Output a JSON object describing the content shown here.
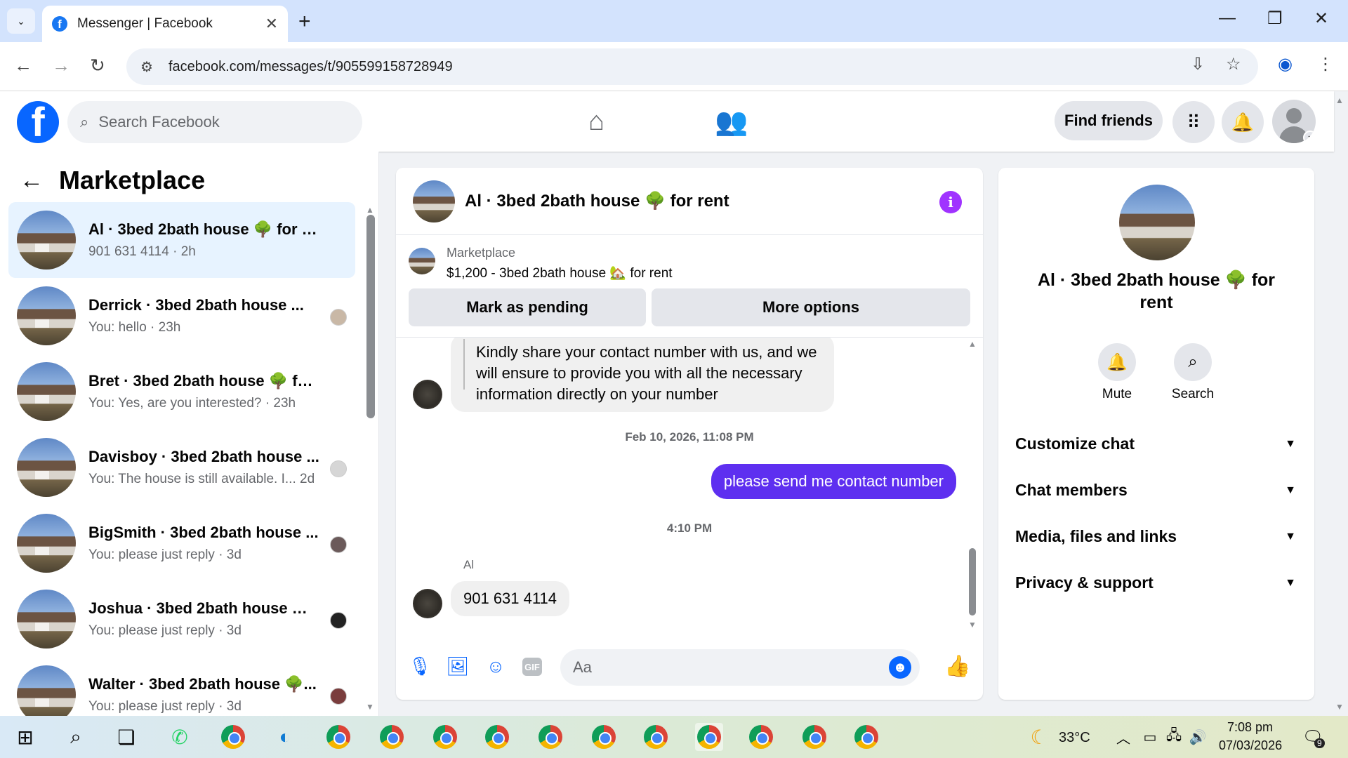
{
  "browser": {
    "tab_title": "Messenger | Facebook",
    "url": "facebook.com/messages/t/905599158728949"
  },
  "fb": {
    "search_placeholder": "Search Facebook",
    "find_friends": "Find friends"
  },
  "sidebar": {
    "title": "Marketplace",
    "conversations": [
      {
        "name": "Al · 3bed 2bath house 🌳 for rent",
        "preview": "901 631 4114 · 2h"
      },
      {
        "name": "Derrick · 3bed 2bath house ...",
        "preview": "You: hello · 23h"
      },
      {
        "name": "Bret · 3bed 2bath house 🌳 for r...",
        "preview": "You: Yes, are you interested? · 23h"
      },
      {
        "name": "Davisboy · 3bed 2bath house ...",
        "preview": "You: The house is still available. I...  2d"
      },
      {
        "name": "BigSmith · 3bed 2bath house ...",
        "preview": "You: please just reply · 3d"
      },
      {
        "name": "Joshua · 3bed 2bath house 🌳...",
        "preview": "You: please just reply · 3d"
      },
      {
        "name": "Walter · 3bed 2bath house 🌳...",
        "preview": "You: please just reply · 3d"
      }
    ]
  },
  "chat": {
    "title": "Al · 3bed 2bath house 🌳 for rent",
    "listing_category": "Marketplace",
    "listing_price": "$1,200 - 3bed 2bath house 🏡 for rent",
    "mark_pending": "Mark as pending",
    "more_options": "More options",
    "msg1": "Kindly share your contact number with us, and we will ensure to provide you with all the necessary information directly on your number",
    "timestamp1": "Feb 10, 2026, 11:08 PM",
    "msg2": "please send me contact number",
    "timestamp2": "4:10 PM",
    "sender": "Al",
    "msg3": "901 631 4114",
    "composer_placeholder": "Aa"
  },
  "info": {
    "name": "Al · 3bed 2bath house 🌳 for rent",
    "mute": "Mute",
    "search": "Search",
    "sections": [
      "Customize chat",
      "Chat members",
      "Media, files and links",
      "Privacy & support"
    ]
  },
  "taskbar": {
    "temp": "33°C",
    "time": "7:08 pm",
    "date": "07/03/2026",
    "notif": "9"
  }
}
